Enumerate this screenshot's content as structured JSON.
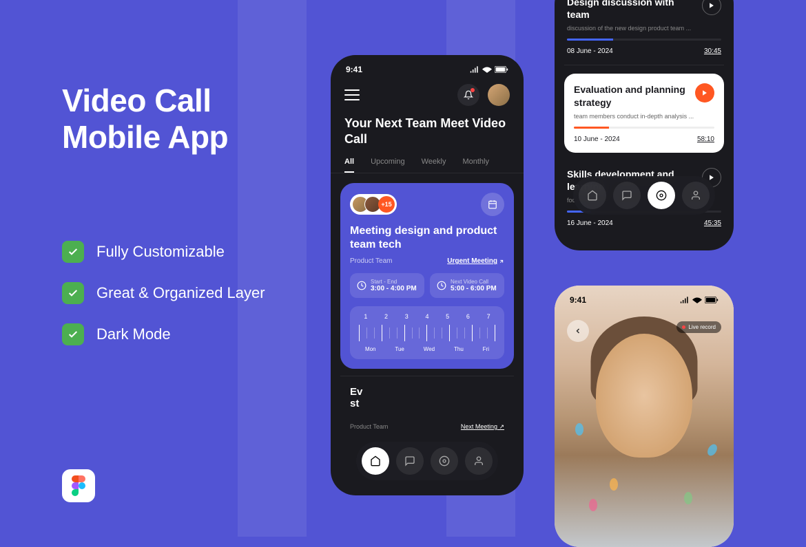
{
  "headline": {
    "line1": "Video Call",
    "line2": "Mobile App"
  },
  "features": [
    "Fully Customizable",
    "Great & Organized Layer",
    "Dark Mode"
  ],
  "phone1": {
    "time": "9:41",
    "title": "Your Next Team Meet Video Call",
    "tabs": [
      "All",
      "Upcoming",
      "Weekly",
      "Monthly"
    ],
    "card": {
      "extra_count": "+15",
      "title": "Meeting design and product team tech",
      "team": "Product Team",
      "urgent": "Urgent Meeting",
      "timebox1_label": "Start - End",
      "timebox1_val": "3:00 - 4:00 PM",
      "timebox2_label": "Next Video Call",
      "timebox2_val": "5:00 - 6:00 PM",
      "week_nums": [
        "1",
        "2",
        "3",
        "4",
        "5",
        "6",
        "7"
      ],
      "week_days": [
        "Mon",
        "Tue",
        "Wed",
        "Thu",
        "Fri"
      ]
    },
    "partial": {
      "title_prefix": "Ev",
      "title_line2": "st",
      "team": "Product Team",
      "next": "Next Meeting"
    }
  },
  "phone2": {
    "cards": [
      {
        "title": "Design discussion with team",
        "desc": "discussion of the new design product team ...",
        "date": "08 June - 2024",
        "dur": "30:45"
      },
      {
        "title": "Evaluation and planning strategy",
        "desc": "team members conduct in-depth analysis ...",
        "date": "10 June - 2024",
        "dur": "58:10"
      },
      {
        "title": "Skills development and learning",
        "desc": "foc",
        "date": "16 June - 2024",
        "dur": "45:35"
      }
    ]
  },
  "phone3": {
    "time": "9:41",
    "live_label": "Live record"
  }
}
